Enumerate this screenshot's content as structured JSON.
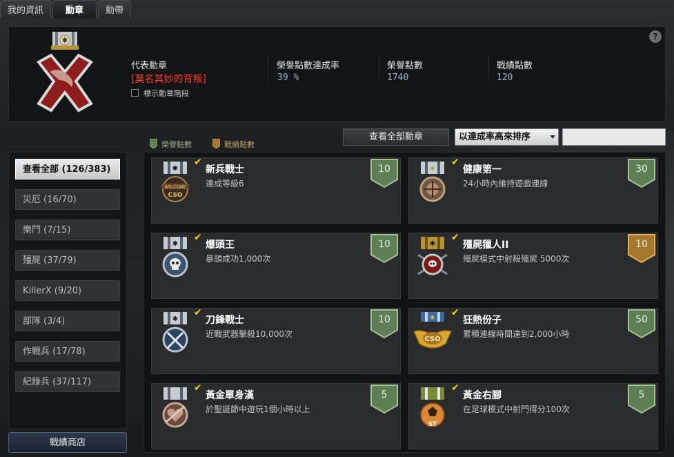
{
  "tabs": [
    {
      "label": "我的資訊"
    },
    {
      "label": "勳章"
    },
    {
      "label": "勳帶"
    }
  ],
  "header": {
    "rep_label": "代表勳章",
    "rep_name": "[莫名其妙的背叛]",
    "show_stage_label": "標示勳章階段",
    "stats": [
      {
        "label": "榮譽點數達成率",
        "value": "39 %"
      },
      {
        "label": "榮譽點數",
        "value": "1740"
      },
      {
        "label": "戰績點數",
        "value": "120"
      }
    ],
    "help": "?"
  },
  "legend": {
    "honor": "榮譽點數",
    "record": "戰績點數"
  },
  "controls": {
    "view_all": "查看全部勳章",
    "sort_selected": "以達成率高來排序"
  },
  "sidebar": {
    "items": [
      {
        "label": "查看全部 (126/383)"
      },
      {
        "label": "災厄 (16/70)"
      },
      {
        "label": "樂鬥 (7/15)"
      },
      {
        "label": "殭屍 (37/79)"
      },
      {
        "label": "KillerX (9/20)"
      },
      {
        "label": "部隊 (3/4)"
      },
      {
        "label": "作戰兵 (17/78)"
      },
      {
        "label": "紀錄兵 (37/117)"
      }
    ],
    "shop": "戰績商店"
  },
  "medals": [
    {
      "title": "新兵戰士",
      "desc": "達成等級6",
      "points": "10",
      "badge_type": "honor",
      "icon": "welcome-cso-medal-icon"
    },
    {
      "title": "健康第一",
      "desc": "24小時內維持遊戲連線",
      "points": "30",
      "badge_type": "honor",
      "icon": "health-medal-icon"
    },
    {
      "title": "爆頭王",
      "desc": "暴頭成功1,000次",
      "points": "10",
      "badge_type": "honor",
      "icon": "skull-medal-icon"
    },
    {
      "title": "殭屍獵人II",
      "desc": "殭屍模式中射殺殭屍 5000次",
      "points": "10",
      "badge_type": "record",
      "icon": "zombie-hunter-medal-icon"
    },
    {
      "title": "刀鋒戰士",
      "desc": "近戰武器擊殺10,000次",
      "points": "10",
      "badge_type": "honor",
      "icon": "blade-medal-icon"
    },
    {
      "title": "狂熱份子",
      "desc": "累積連線時間達到2,000小時",
      "points": "50",
      "badge_type": "honor",
      "icon": "cso-wings-medal-icon"
    },
    {
      "title": "黃金單身漢",
      "desc": "於聖誕節中遊玩1個小時以上",
      "points": "5",
      "badge_type": "honor",
      "icon": "bachelor-medal-icon"
    },
    {
      "title": "黃金右腳",
      "desc": "在足球模式中射門得分100次",
      "points": "5",
      "badge_type": "honor",
      "icon": "soccer-medal-icon"
    }
  ],
  "colors": {
    "honor_badge": "#5e7e55",
    "record_badge": "#a6782c",
    "rep_name": "#ff3c28",
    "check": "#f5d31a"
  }
}
